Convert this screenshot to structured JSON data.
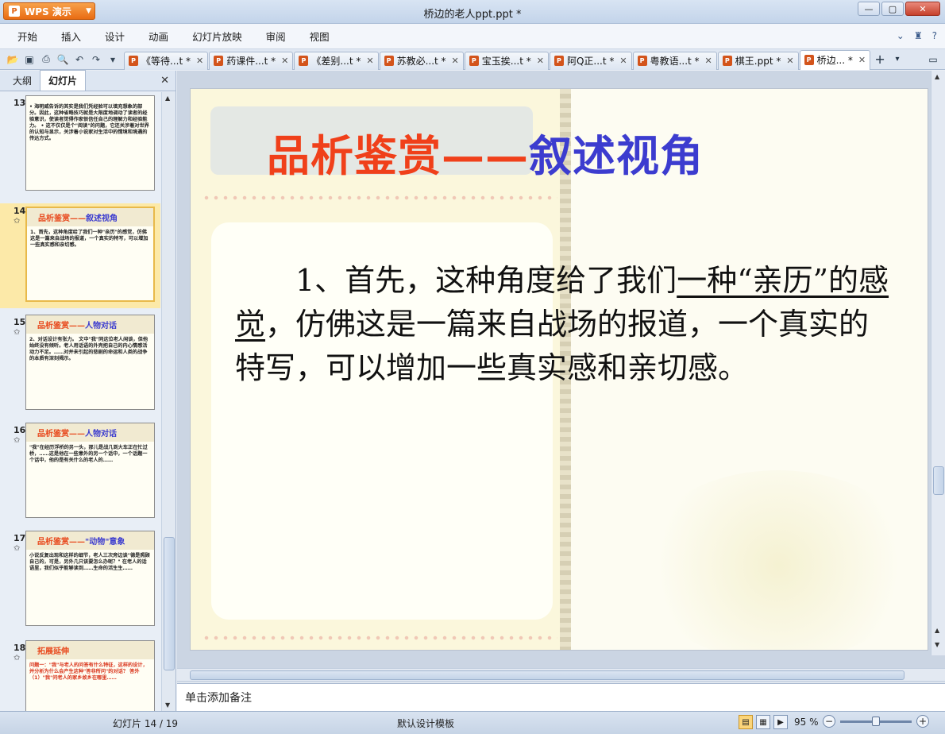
{
  "app": {
    "name": "WPS 演示",
    "window_title": "桥边的老人ppt.ppt *"
  },
  "menu": [
    "开始",
    "插入",
    "设计",
    "动画",
    "幻灯片放映",
    "审阅",
    "视图"
  ],
  "tabs": [
    {
      "label": "《等待...t *",
      "active": false
    },
    {
      "label": "药课件...t *",
      "active": false
    },
    {
      "label": "《差别...t *",
      "active": false
    },
    {
      "label": "苏教必...t *",
      "active": false
    },
    {
      "label": "宝玉挨...t *",
      "active": false
    },
    {
      "label": "阿Q正...t *",
      "active": false
    },
    {
      "label": "粤教语...t *",
      "active": false
    },
    {
      "label": "棋王.ppt *",
      "active": false
    },
    {
      "label": "桥边... *",
      "active": true
    }
  ],
  "left_panel": {
    "tab_outline": "大纲",
    "tab_slides": "幻灯片",
    "thumbs": [
      {
        "num": "13",
        "title_red": "",
        "title_blue": "",
        "body": "• 海明威告诉的其实是我们凭经验可以填充想象的部分。因此，这种省略技巧就是大限度地调动了读者的经验意识，使读者觉得作家很信任自己的理解力和经验能力。 • 这不仅仅是个\"阅读\"的问题，它还关涉着对世界的认知与显示，关涉着小说家对生活中的情境和境遇的传达方式。",
        "star": false
      },
      {
        "num": "14",
        "title_red": "品析鉴赏——",
        "title_blue": "叙述视角",
        "body": "1、首先，这种角度给了我们一种\"亲历\"的感觉，仿佛这是一篇来自战场的报道，一个真实的特写，可以增加一些真实感和亲切感。",
        "star": true
      },
      {
        "num": "15",
        "title_red": "品析鉴赏——",
        "title_blue": "人物对话",
        "body": "2、对话设计有张力。 文中\"我\"同这位老人闲谈，但他始终没有倾听。老人用话语的外壳把自己的内心情感活动力不足。……对并未引起的悲剧的命运和人类的战争的本质有深刻揭示。",
        "star": true
      },
      {
        "num": "16",
        "title_red": "品析鉴赏——",
        "title_blue": "人物对话",
        "body": "\"我\"在经历浮桥的另一头，那儿是战几到大车正在忙过桥，……这是他在一些意外的另一个话中，一个话题一个话中，他的是有关什么的老人的……",
        "star": true
      },
      {
        "num": "17",
        "title_red": "品析鉴赏——",
        "title_blue": "\"动物\"意象",
        "body": "小说反复出现和这样的细节，老人三次旁边谈\"德是照顾自己的，可是，另外几只该要怎么办呢？\" 在老人的话语里，我们似乎能够读到……生命的活生生……",
        "star": true
      },
      {
        "num": "18",
        "title_red": "拓展延伸",
        "title_blue": "",
        "body": "问题一：\"我\"与老人的问答有什么特征，这样的设计，并分析为什么会产生这种\"答非所问\"的对话？ 答外 （1）\"我\"问老人的家乡故乡在哪里……",
        "star": true
      }
    ]
  },
  "slide": {
    "title_red": "品析鉴赏——",
    "title_blue": "叙述视角",
    "body_prefix": "1、首先，这种角度给了我们",
    "body_underlined": "一种“亲历”的感觉",
    "body_suffix": "，仿佛这是一篇来自战场的报道，一个真实的特写，可以增加一些真实感和亲切感。"
  },
  "notes_placeholder": "单击添加备注",
  "status": {
    "slide_counter": "幻灯片 14 / 19",
    "template": "默认设计模板",
    "zoom": "95 %",
    "zoom_fraction": 0.5
  },
  "colors": {
    "title_red": "#f0401a",
    "title_blue": "#3c3ccf",
    "app_orange": "#e96c13"
  }
}
